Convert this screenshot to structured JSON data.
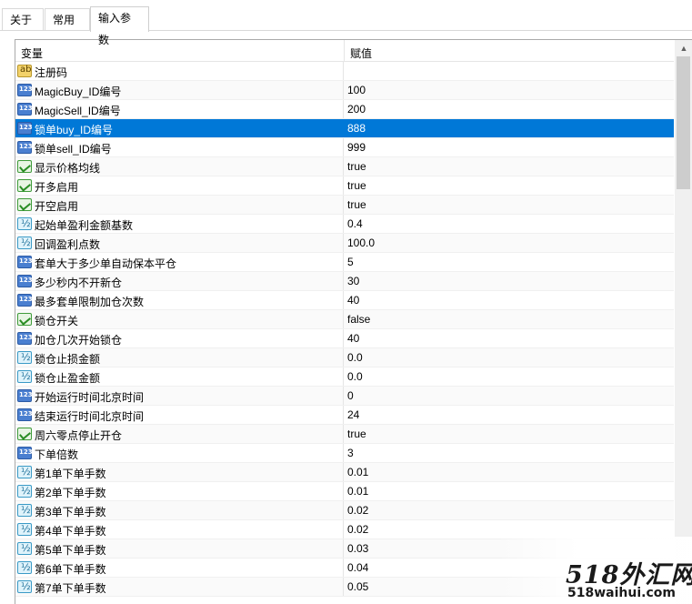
{
  "tabs": [
    "关于",
    "常用",
    "输入参数"
  ],
  "table": {
    "col_variable": "变量",
    "col_value": "赋值",
    "rows": [
      {
        "icon": "string-icon",
        "name": "注册码",
        "value": ""
      },
      {
        "icon": "integer-icon",
        "name": "MagicBuy_ID编号",
        "value": "100"
      },
      {
        "icon": "integer-icon",
        "name": "MagicSell_ID编号",
        "value": "200"
      },
      {
        "icon": "integer-icon",
        "name": "锁单buy_ID编号",
        "value": "888"
      },
      {
        "icon": "integer-icon",
        "name": "锁单sell_ID编号",
        "value": "999"
      },
      {
        "icon": "boolean-icon",
        "name": "显示价格均线",
        "value": "true"
      },
      {
        "icon": "boolean-icon",
        "name": "开多启用",
        "value": "true"
      },
      {
        "icon": "boolean-icon",
        "name": "开空启用",
        "value": "true"
      },
      {
        "icon": "double-icon",
        "name": "起始单盈利金额基数",
        "value": "0.4"
      },
      {
        "icon": "double-icon",
        "name": "回调盈利点数",
        "value": "100.0"
      },
      {
        "icon": "integer-icon",
        "name": "套单大于多少单自动保本平仓",
        "value": "5"
      },
      {
        "icon": "integer-icon",
        "name": "多少秒内不开新仓",
        "value": "30"
      },
      {
        "icon": "integer-icon",
        "name": "最多套单限制加仓次数",
        "value": "40"
      },
      {
        "icon": "boolean-icon",
        "name": "锁仓开关",
        "value": "false"
      },
      {
        "icon": "integer-icon",
        "name": "加仓几次开始锁仓",
        "value": "40"
      },
      {
        "icon": "double-icon",
        "name": "锁仓止损金额",
        "value": "0.0"
      },
      {
        "icon": "double-icon",
        "name": "锁仓止盈金额",
        "value": "0.0"
      },
      {
        "icon": "integer-icon",
        "name": "开始运行时间北京时间",
        "value": "0"
      },
      {
        "icon": "integer-icon",
        "name": "结束运行时间北京时间",
        "value": "24"
      },
      {
        "icon": "boolean-icon",
        "name": "周六零点停止开仓",
        "value": "true"
      },
      {
        "icon": "integer-icon",
        "name": "下单倍数",
        "value": "3"
      },
      {
        "icon": "double-icon",
        "name": "第1单下单手数",
        "value": "0.01"
      },
      {
        "icon": "double-icon",
        "name": "第2单下单手数",
        "value": "0.01"
      },
      {
        "icon": "double-icon",
        "name": "第3单下单手数",
        "value": "0.02"
      },
      {
        "icon": "double-icon",
        "name": "第4单下单手数",
        "value": "0.02"
      },
      {
        "icon": "double-icon",
        "name": "第5单下单手数",
        "value": "0.03"
      },
      {
        "icon": "double-icon",
        "name": "第6单下单手数",
        "value": "0.04"
      },
      {
        "icon": "double-icon",
        "name": "第7单下单手数",
        "value": "0.05"
      }
    ],
    "selected_row": 3
  },
  "watermark": {
    "line1": "518外汇网",
    "line2": "518waihui.com"
  },
  "colors": {
    "selection": "#0078d7",
    "tab_border": "#d9d9d9"
  }
}
